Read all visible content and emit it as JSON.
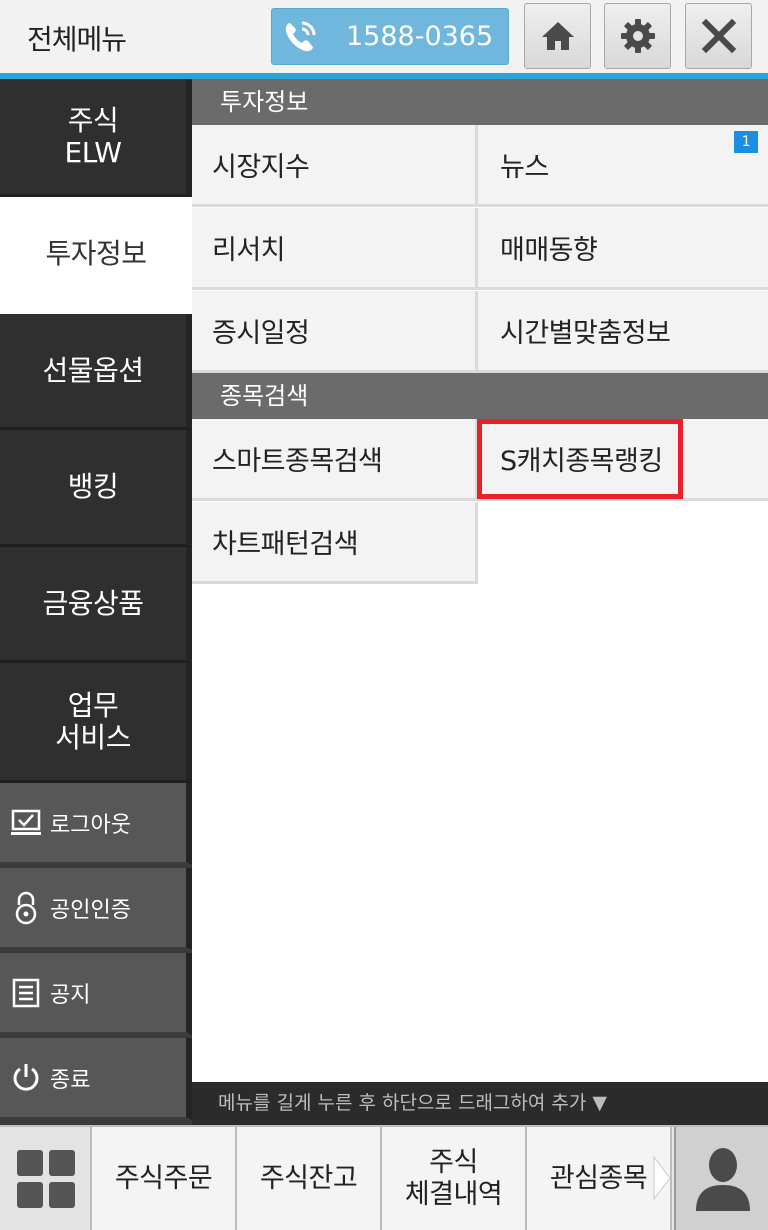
{
  "header": {
    "title": "전체메뉴",
    "phone_number": "1588-0365"
  },
  "sidebar": {
    "items": [
      {
        "label": "주식\nELW"
      },
      {
        "label": "투자정보"
      },
      {
        "label": "선물옵션"
      },
      {
        "label": "뱅킹"
      },
      {
        "label": "금융상품"
      },
      {
        "label": "업무\n서비스"
      }
    ],
    "tools": [
      {
        "label": "로그아웃",
        "icon": "logout-icon"
      },
      {
        "label": "공인인증",
        "icon": "lock-icon"
      },
      {
        "label": "공지",
        "icon": "notice-icon"
      },
      {
        "label": "종료",
        "icon": "power-icon"
      }
    ]
  },
  "main": {
    "sections": [
      {
        "title": "투자정보",
        "items": [
          "시장지수",
          "뉴스",
          "리서치",
          "매매동향",
          "증시일정",
          "시간별맞춤정보"
        ]
      },
      {
        "title": "종목검색",
        "items": [
          "스마트종목검색",
          "S캐치종목랭킹",
          "차트패턴검색"
        ]
      }
    ],
    "news_badge": "1",
    "hint": "메뉴를 길게 누른 후 하단으로 드래그하여 추가 ▼"
  },
  "bottom_bar": {
    "items": [
      "주식주문",
      "주식잔고",
      "주식\n체결내역",
      "관심종목"
    ]
  },
  "colors": {
    "accent": "#2aa3d8",
    "phone_button": "#6fb7dc",
    "highlight": "#e8212a"
  }
}
